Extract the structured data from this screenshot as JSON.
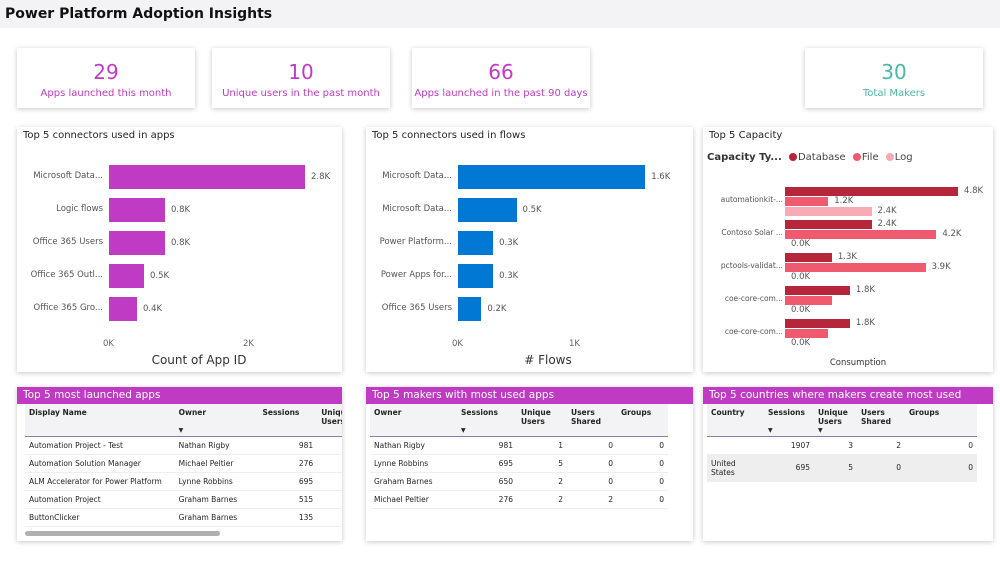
{
  "header": {
    "title": "Power Platform Adoption Insights"
  },
  "kpis": [
    {
      "value": "29",
      "label": "Apps launched this month",
      "color": "#c03bc4"
    },
    {
      "value": "10",
      "label": "Unique users in the past month",
      "color": "#c03bc4"
    },
    {
      "value": "66",
      "label": "Apps launched in the past 90 days",
      "color": "#c03bc4"
    },
    {
      "value": "30",
      "label": "Total Makers",
      "color": "#4ab8a8"
    }
  ],
  "chart_data": [
    {
      "type": "bar",
      "orientation": "horizontal",
      "title": "Top 5 connectors used in apps",
      "categories": [
        "Microsoft Data...",
        "Logic flows",
        "Office 365 Users",
        "Office 365 Outl...",
        "Office 365 Gro..."
      ],
      "values": [
        2800,
        800,
        800,
        500,
        400
      ],
      "data_labels": [
        "2.8K",
        "0.8K",
        "0.8K",
        "0.5K",
        "0.4K"
      ],
      "xlabel": "Count of App ID",
      "xticks": [
        "0K",
        "2K"
      ],
      "xlim": [
        0,
        2000
      ],
      "color": "#c03bc4"
    },
    {
      "type": "bar",
      "orientation": "horizontal",
      "title": "Top 5 connectors used in flows",
      "categories": [
        "Microsoft Data...",
        "Microsoft Data...",
        "Power Platform...",
        "Power Apps for...",
        "Office 365 Users"
      ],
      "values": [
        1600,
        500,
        300,
        300,
        200
      ],
      "data_labels": [
        "1.6K",
        "0.5K",
        "0.3K",
        "0.3K",
        "0.2K"
      ],
      "xlabel": "# Flows",
      "xticks": [
        "0K",
        "1K"
      ],
      "xlim": [
        0,
        1000
      ],
      "color": "#0078d4"
    },
    {
      "type": "bar",
      "orientation": "horizontal",
      "title": "Top 5 Capacity",
      "legend_title": "Capacity Ty...",
      "legend": "top-left",
      "xlabel": "Consumption",
      "categories": [
        "automationkit-...",
        "Contoso Solar ...",
        "pctools-validat...",
        "coe-core-com...",
        "coe-core-com..."
      ],
      "series": [
        {
          "name": "Database",
          "color": "#b6263a",
          "values": [
            4800,
            2400,
            1300,
            1800,
            1800
          ],
          "labels": [
            "4.8K",
            "2.4K",
            "1.3K",
            "1.8K",
            "1.8K"
          ]
        },
        {
          "name": "File",
          "color": "#f05a6e",
          "values": [
            1200,
            4200,
            3900,
            1300,
            1200
          ],
          "labels": [
            "1.2K",
            "4.2K",
            "3.9K",
            "",
            ""
          ]
        },
        {
          "name": "Log",
          "color": "#f8aab5",
          "values": [
            2400,
            0,
            0,
            0,
            0
          ],
          "labels": [
            "2.4K",
            "0.0K",
            "0.0K",
            "0.0K",
            "0.0K"
          ]
        }
      ]
    }
  ],
  "tables": [
    {
      "title": "Top 5 most launched apps",
      "columns": [
        "Display Name",
        "Owner",
        "Sessions",
        "Unique Users"
      ],
      "rows": [
        [
          "Automation Project - Test",
          "Nathan Rigby",
          "981"
        ],
        [
          "Automation Solution Manager",
          "Michael Peltier",
          "276"
        ],
        [
          "ALM Accelerator for Power Platform",
          "Lynne Robbins",
          "695"
        ],
        [
          "Automation Project",
          "Graham Barnes",
          "515"
        ],
        [
          "ButtonClicker",
          "Graham Barnes",
          "135"
        ]
      ]
    },
    {
      "title": "Top 5 makers with most used apps",
      "columns": [
        "Owner",
        "Sessions",
        "Unique Users",
        "Users Shared",
        "Groups"
      ],
      "rows": [
        [
          "Nathan Rigby",
          "981",
          "1",
          "0",
          "0"
        ],
        [
          "Lynne Robbins",
          "695",
          "5",
          "0",
          "0"
        ],
        [
          "Graham Barnes",
          "650",
          "2",
          "0",
          "0"
        ],
        [
          "Michael Peltier",
          "276",
          "2",
          "2",
          "0"
        ]
      ]
    },
    {
      "title": "Top 5 countries where makers create most used apps",
      "columns": [
        "Country",
        "Sessions",
        "Unique Users",
        "Users Shared",
        "Groups"
      ],
      "rows": [
        [
          "",
          "1907",
          "3",
          "2",
          "0"
        ],
        [
          "United States",
          "695",
          "5",
          "0",
          "0"
        ]
      ]
    }
  ]
}
